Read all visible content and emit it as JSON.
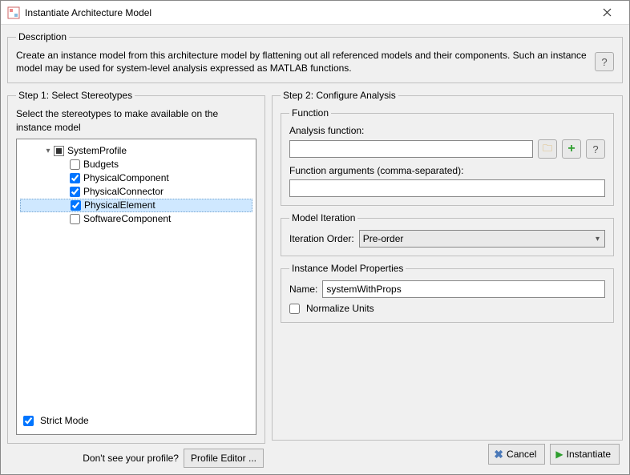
{
  "titlebar": {
    "title": "Instantiate Architecture Model"
  },
  "description": {
    "legend": "Description",
    "text": "Create an instance model from this architecture model by flattening out all referenced models and their components. Such an instance model may be used for system-level analysis expressed as MATLAB functions."
  },
  "step1": {
    "legend": "Step 1: Select Stereotypes",
    "hint": "Select the stereotypes to make available on the instance model",
    "tree": {
      "root": "SystemProfile",
      "items": [
        {
          "label": "Budgets",
          "checked": "false"
        },
        {
          "label": "PhysicalComponent",
          "checked": "true"
        },
        {
          "label": "PhysicalConnector",
          "checked": "true"
        },
        {
          "label": "PhysicalElement",
          "checked": "true",
          "selected": true
        },
        {
          "label": "SoftwareComponent",
          "checked": "false"
        }
      ]
    },
    "strict_mode_label": "Strict Mode",
    "strict_mode_checked": "true",
    "profile_hint": "Don't see your profile?",
    "profile_button": "Profile Editor ..."
  },
  "step2": {
    "legend": "Step 2: Configure Analysis",
    "function_group": {
      "legend": "Function",
      "analysis_label": "Analysis function:",
      "analysis_value": "",
      "args_label": "Function arguments (comma-separated):",
      "args_value": ""
    },
    "iteration_group": {
      "legend": "Model Iteration",
      "order_label": "Iteration Order:",
      "order_value": "Pre-order"
    },
    "props_group": {
      "legend": "Instance Model Properties",
      "name_label": "Name:",
      "name_value": "systemWithProps",
      "normalize_label": "Normalize Units",
      "normalize_checked": "false"
    }
  },
  "buttons": {
    "cancel": "Cancel",
    "instantiate": "Instantiate"
  }
}
